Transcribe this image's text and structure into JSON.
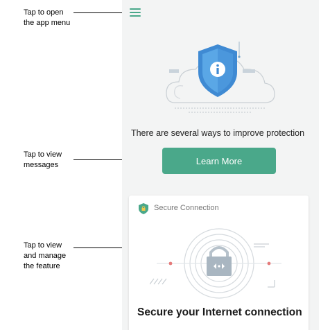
{
  "callouts": {
    "menu": [
      "Tap to open",
      "the app menu"
    ],
    "messages": [
      "Tap to view",
      "messages"
    ],
    "feature": [
      "Tap to view",
      "and manage",
      "the feature"
    ]
  },
  "app": {
    "menu_icon": "hamburger-menu-icon",
    "hero_icon": "shield-info-icon",
    "protection_message": "There are several ways to improve protection",
    "learn_more_label": "Learn More",
    "accent_color": "#4aa88a",
    "card": {
      "icon": "shield-lock-icon",
      "title": "Secure Connection",
      "illustration_icon": "padlock-icon",
      "heading": "Secure your Internet connection"
    }
  }
}
